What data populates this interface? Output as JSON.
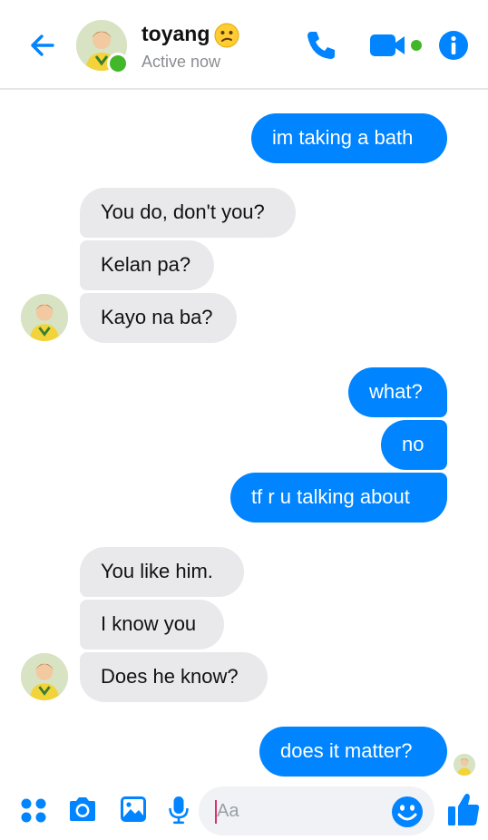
{
  "header": {
    "contact_name": "toyang",
    "status": "Active now",
    "accent": "#0084ff"
  },
  "messages": [
    {
      "from": "me",
      "text": "im taking a bath"
    },
    {
      "from": "them",
      "text": "You do, don't you?"
    },
    {
      "from": "them",
      "text": "Kelan pa?"
    },
    {
      "from": "them",
      "text": "Kayo na ba?"
    },
    {
      "from": "me",
      "text": "what?"
    },
    {
      "from": "me",
      "text": "no"
    },
    {
      "from": "me",
      "text": "tf r u talking about"
    },
    {
      "from": "them",
      "text": "You like him."
    },
    {
      "from": "them",
      "text": "I know you"
    },
    {
      "from": "them",
      "text": "Does he know?"
    },
    {
      "from": "me",
      "text": "does it matter?"
    }
  ],
  "composer": {
    "placeholder": "Aa"
  },
  "icons": {
    "back": "arrow-left-icon",
    "call": "phone-icon",
    "video": "video-camera-icon",
    "info": "info-icon",
    "apps": "apps-grid-icon",
    "camera": "camera-icon",
    "gallery": "image-icon",
    "mic": "microphone-icon",
    "emoji": "smiley-icon",
    "like": "thumbs-up-icon"
  },
  "colors": {
    "outgoing_bubble": "#0084ff",
    "incoming_bubble": "#e9e9eb",
    "online": "#42b72a"
  }
}
